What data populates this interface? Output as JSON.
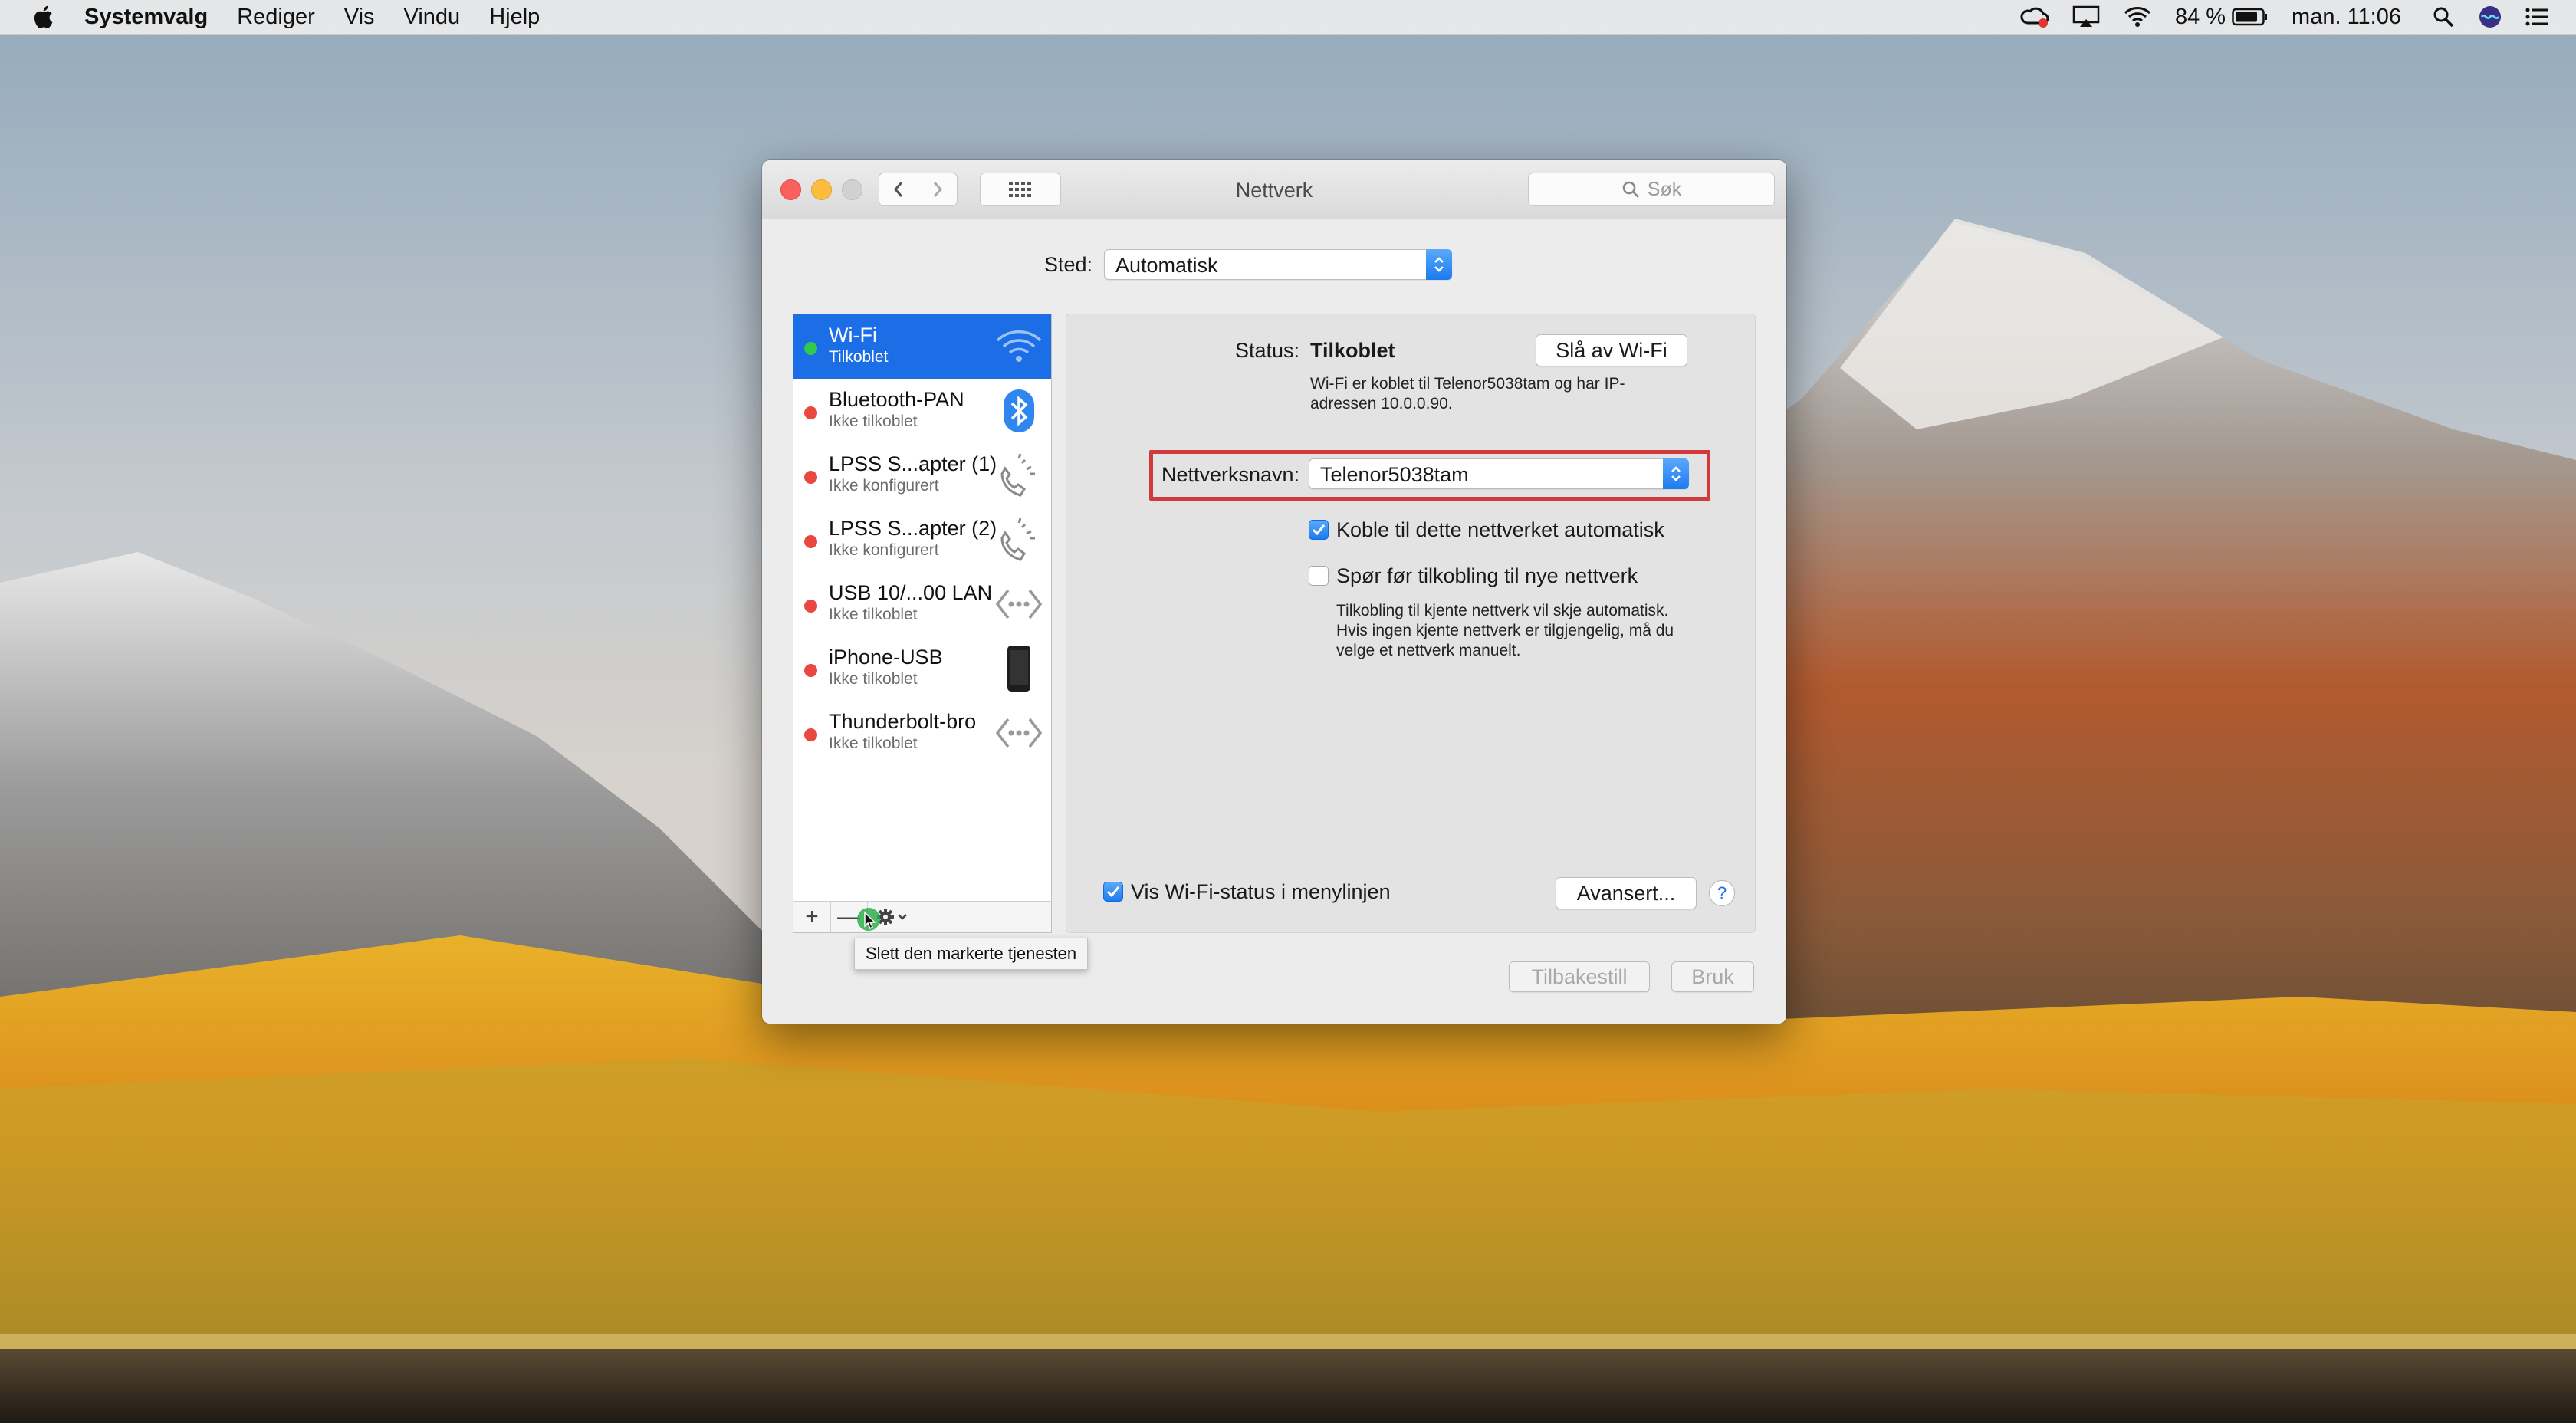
{
  "menubar": {
    "app_name": "Systemvalg",
    "items": [
      "Rediger",
      "Vis",
      "Vindu",
      "Hjelp"
    ],
    "battery": "84 %",
    "clock": "man. 11:06",
    "icons": [
      "creative-cloud-icon",
      "airplay-icon",
      "wifi-icon",
      "battery-icon",
      "spotlight-icon",
      "siri-icon",
      "notification-center-icon"
    ]
  },
  "window": {
    "title": "Nettverk",
    "search_placeholder": "Søk",
    "location_label": "Sted:",
    "location_value": "Automatisk"
  },
  "services": [
    {
      "name": "Wi-Fi",
      "status": "Tilkoblet",
      "dot": "#34c84a",
      "icon": "wifi-icon",
      "selected": true
    },
    {
      "name": "Bluetooth-PAN",
      "status": "Ikke tilkoblet",
      "dot": "#e8483f",
      "icon": "bluetooth-icon"
    },
    {
      "name": "LPSS S...apter (1)",
      "status": "Ikke konfigurert",
      "dot": "#e8483f",
      "icon": "phone-icon"
    },
    {
      "name": "LPSS S...apter (2)",
      "status": "Ikke konfigurert",
      "dot": "#e8483f",
      "icon": "phone-icon"
    },
    {
      "name": "USB 10/...00 LAN",
      "status": "Ikke tilkoblet",
      "dot": "#e8483f",
      "icon": "ethernet-icon"
    },
    {
      "name": "iPhone-USB",
      "status": "Ikke tilkoblet",
      "dot": "#e8483f",
      "icon": "iphone-icon"
    },
    {
      "name": "Thunderbolt-bro",
      "status": "Ikke tilkoblet",
      "dot": "#e8483f",
      "icon": "ethernet-icon"
    }
  ],
  "list_toolbar": {
    "add": "+",
    "remove": "—"
  },
  "detail": {
    "status_label": "Status:",
    "status_value": "Tilkoblet",
    "turn_off_button": "Slå av Wi-Fi",
    "status_desc_1": "Wi-Fi er koblet til Telenor5038tam og har IP-",
    "status_desc_2": "adressen 10.0.0.90.",
    "network_name_label": "Nettverksnavn:",
    "network_name_value": "Telenor5038tam",
    "auto_join_label": "Koble til dette nettverket automatisk",
    "auto_join_checked": true,
    "ask_join_label": "Spør før tilkobling til nye nettverk",
    "ask_join_checked": false,
    "ask_desc_1": "Tilkobling til kjente nettverk vil skje automatisk.",
    "ask_desc_2": "Hvis ingen kjente nettverk er tilgjengelig, må du",
    "ask_desc_3": "velge et nettverk manuelt.",
    "show_status_label": "Vis Wi-Fi-status i menylinjen",
    "show_status_checked": true,
    "advanced_button": "Avansert...",
    "help": "?"
  },
  "footer": {
    "revert_button": "Tilbakestill",
    "apply_button": "Bruk"
  },
  "tooltip": "Slett den markerte tjenesten",
  "colors": {
    "accent": "#1b6ee6",
    "highlight_frame": "#d03a3a"
  }
}
